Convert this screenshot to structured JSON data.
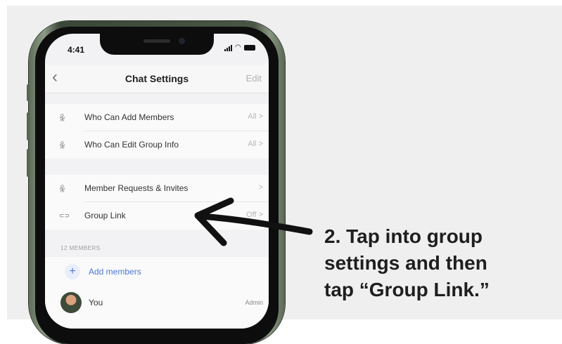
{
  "phone": {
    "status_time": "4:41",
    "nav": {
      "back": "‹",
      "title": "Chat Settings",
      "edit": "Edit"
    },
    "settings_group_1": [
      {
        "icon": "people-icon",
        "glyph": "ꆜ",
        "label": "Who Can Add Members",
        "value": "All >"
      },
      {
        "icon": "people-icon",
        "glyph": "ꆜ",
        "label": "Who Can Edit Group Info",
        "value": "All >"
      }
    ],
    "settings_group_2": [
      {
        "icon": "person-add-icon",
        "glyph": "ꆜ",
        "label": "Member Requests & Invites",
        "value": ">"
      },
      {
        "icon": "link-icon",
        "glyph": "⊂⊃",
        "label": "Group Link",
        "value": "Off >"
      }
    ],
    "members_section": {
      "header": "12 MEMBERS",
      "add_label": "Add members",
      "add_glyph": "+",
      "member": {
        "name": "You",
        "role": "Admin"
      }
    }
  },
  "caption": {
    "line1": "2. Tap into group",
    "line2": "settings and then",
    "line3": "tap “Group Link.”"
  },
  "colors": {
    "accent": "#4d77d6",
    "caption_text": "#1e1e1e",
    "background": "#efefef"
  }
}
